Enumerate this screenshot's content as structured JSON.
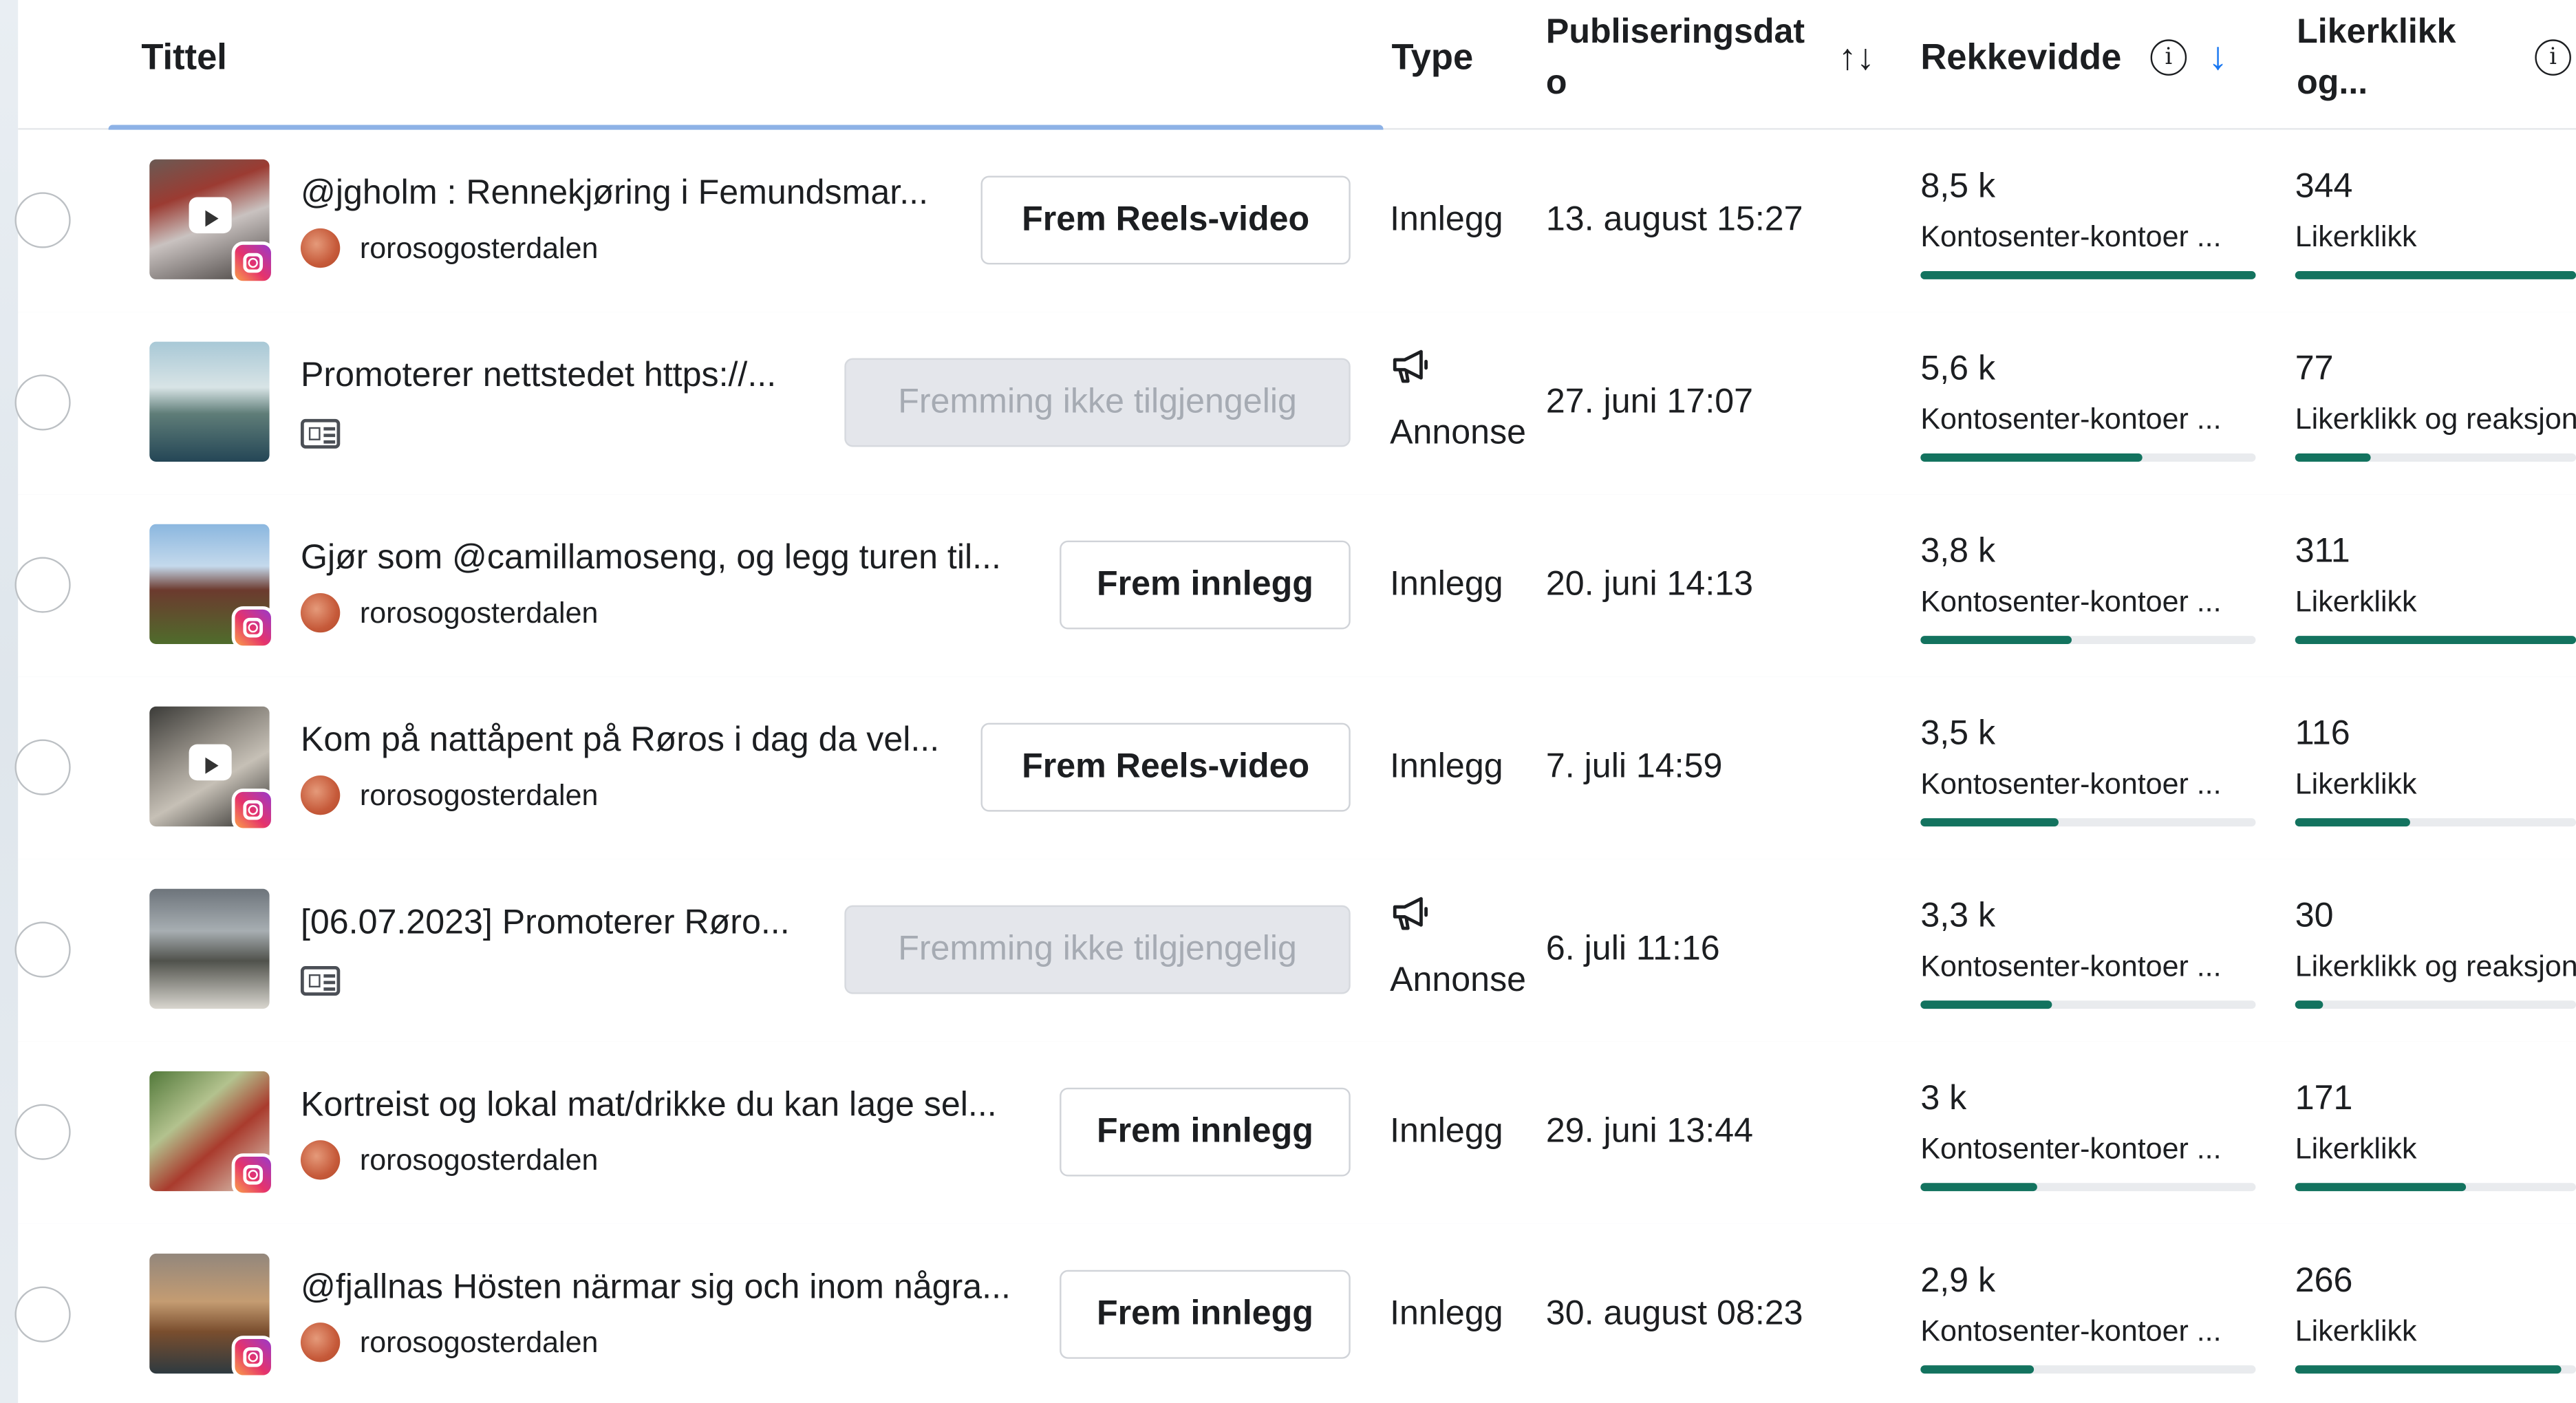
{
  "header": {
    "title": "Tittel",
    "type": "Type",
    "date_line1": "Publiseringsdat",
    "date_line2": "o",
    "sort_arrows": "↑↓",
    "reach": "Rekkevidde",
    "sort_down": "↓",
    "likes_line1": "Likerklikk",
    "likes_line2": "og...",
    "info": "i"
  },
  "rows": [
    {
      "title": "@jgholm : Rennekjøring i Femundsmar...",
      "account": "rorosogosterdalen",
      "button": "Frem Reels-video",
      "button_enabled": true,
      "media": "reels",
      "type": "Innlegg",
      "date": "13. august 15:27",
      "reach": "8,5 k",
      "reach_sub": "Kontosenter-kontoer ...",
      "reach_frac": 1.0,
      "likes": "344",
      "likes_sub": "Likerklikk",
      "likes_frac": 1.0
    },
    {
      "title": "Promoterer nettstedet https://...",
      "account": "",
      "button": "Fremming ikke tilgjengelig",
      "button_enabled": false,
      "media": "ad",
      "type": "Annonse",
      "date": "27. juni 17:07",
      "reach": "5,6 k",
      "reach_sub": "Kontosenter-kontoer ...",
      "reach_frac": 0.66,
      "likes": "77",
      "likes_sub": "Likerklikk og reaksjoner",
      "likes_frac": 0.27
    },
    {
      "title": "Gjør som @camillamoseng, og legg turen til...",
      "account": "rorosogosterdalen",
      "button": "Frem innlegg",
      "button_enabled": true,
      "media": "post",
      "type": "Innlegg",
      "date": "20. juni 14:13",
      "reach": "3,8 k",
      "reach_sub": "Kontosenter-kontoer ...",
      "reach_frac": 0.45,
      "likes": "311",
      "likes_sub": "Likerklikk",
      "likes_frac": 1.0
    },
    {
      "title": "Kom på nattåpent på Røros i dag da vel...",
      "account": "rorosogosterdalen",
      "button": "Frem Reels-video",
      "button_enabled": true,
      "media": "reels",
      "type": "Innlegg",
      "date": "7. juli 14:59",
      "reach": "3,5 k",
      "reach_sub": "Kontosenter-kontoer ...",
      "reach_frac": 0.41,
      "likes": "116",
      "likes_sub": "Likerklikk",
      "likes_frac": 0.41
    },
    {
      "title": "[06.07.2023] Promoterer Røro...",
      "account": "",
      "button": "Fremming ikke tilgjengelig",
      "button_enabled": false,
      "media": "ad",
      "type": "Annonse",
      "date": "6. juli 11:16",
      "reach": "3,3 k",
      "reach_sub": "Kontosenter-kontoer ...",
      "reach_frac": 0.39,
      "likes": "30",
      "likes_sub": "Likerklikk og reaksjoner",
      "likes_frac": 0.1
    },
    {
      "title": "Kortreist og lokal mat/drikke du kan lage sel...",
      "account": "rorosogosterdalen",
      "button": "Frem innlegg",
      "button_enabled": true,
      "media": "post",
      "type": "Innlegg",
      "date": "29. juni 13:44",
      "reach": "3 k",
      "reach_sub": "Kontosenter-kontoer ...",
      "reach_frac": 0.35,
      "likes": "171",
      "likes_sub": "Likerklikk",
      "likes_frac": 0.61
    },
    {
      "title": "@fjallnas Hösten närmar sig och inom några...",
      "account": "rorosogosterdalen",
      "button": "Frem innlegg",
      "button_enabled": true,
      "media": "post",
      "type": "Innlegg",
      "date": "30. august 08:23",
      "reach": "2,9 k",
      "reach_sub": "Kontosenter-kontoer ...",
      "reach_frac": 0.34,
      "likes": "266",
      "likes_sub": "Likerklikk",
      "likes_frac": 0.95
    }
  ],
  "colors": {
    "bar": "#13735f",
    "accent_blue": "#1877f2",
    "instagram": "#e6336b",
    "orange_deco": "#e35a1f"
  }
}
